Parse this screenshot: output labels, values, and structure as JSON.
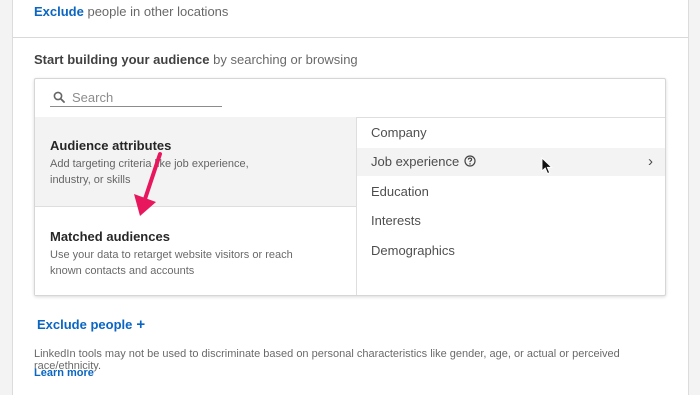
{
  "targeting": {
    "exclude_link": "Exclude",
    "exclude_text": " people in other locations"
  },
  "audience": {
    "heading_bold": "Start building your audience",
    "heading_rest": " by searching or browsing",
    "search_placeholder": "Search"
  },
  "categories": [
    {
      "title": "Audience attributes",
      "description_line1": "Add targeting criteria like job experience,",
      "description_line2": "industry, or skills"
    },
    {
      "title": "Matched audiences",
      "description_line1": "Use your data to retarget website visitors or reach",
      "description_line2": "known contacts and accounts"
    }
  ],
  "subcategories": [
    "Company",
    "Job experience",
    "Education",
    "Interests",
    "Demographics"
  ],
  "exclude_people": {
    "label": "Exclude people",
    "icon": "plus-icon"
  },
  "footer": {
    "disclaimer": "LinkedIn tools may not be used to discriminate based on personal characteristics like gender, age, or actual or perceived race/ethnicity.",
    "learn_more": "Learn more"
  },
  "colors": {
    "link": "#0a66c2",
    "annotation_arrow": "#e8175d",
    "selected_bg": "#f3f3f3"
  }
}
